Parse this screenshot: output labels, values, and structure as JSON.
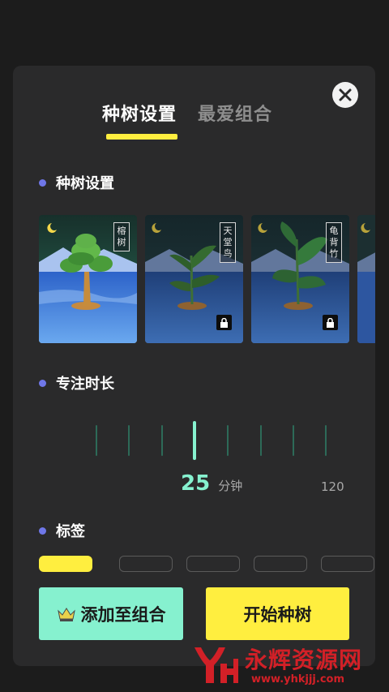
{
  "tabs": [
    {
      "label": "种树设置",
      "active": true
    },
    {
      "label": "最爱组合",
      "active": false
    }
  ],
  "sections": {
    "tree": "种树设置",
    "duration": "专注时长",
    "tag": "标签"
  },
  "trees": [
    {
      "name": "榕树",
      "locked": false
    },
    {
      "name": "天堂鸟",
      "locked": true
    },
    {
      "name": "龟背竹",
      "locked": true
    },
    {
      "name": "",
      "locked": false
    }
  ],
  "duration": {
    "value": "25",
    "unit": "分钟",
    "max": "120",
    "selected_level": 25
  },
  "buttons": {
    "add_to_combo": "添加至组合",
    "start": "开始种树"
  },
  "watermark": {
    "text": "永辉资源网",
    "url": "www.yhkjjj.com"
  },
  "colors": {
    "accent_yellow": "#ffee3f",
    "accent_green": "#86f1cf",
    "dot": "#6f77e8",
    "panel": "#2a2a2b"
  },
  "icons": {
    "close": "close-icon",
    "lock": "lock-icon",
    "crown": "crown-icon",
    "moon": "moon-icon"
  }
}
